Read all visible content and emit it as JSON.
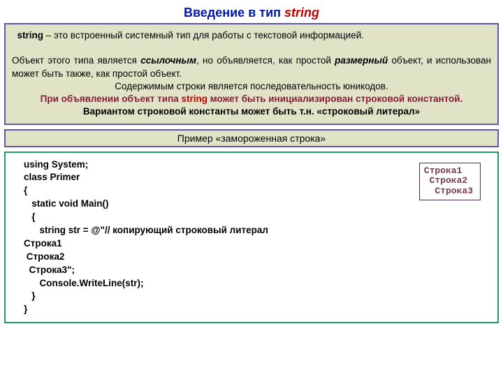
{
  "title_prefix": "Введение в тип ",
  "title_keyword": "string",
  "panel1": {
    "line1_pre": "string",
    "line1_rest": " – это встроенный системный тип для работы с текстовой информацией.",
    "line2_pre": "Объект этого типа является ",
    "line2_em": "ссылочным",
    "line2_mid": ", но объявляется, как простой ",
    "line2_em2": "размерный",
    "line2_post": " объект, и использован может быть также, как простой объект.",
    "line3": "Содержимым  строки  является последовательность юникодов.",
    "line4_pre": "При объявлении объект типа ",
    "line4_kw": "string",
    "line4_post": " может быть инициализирован строковой константой.",
    "line5": "Вариантом строковой константы может быть т.н. «строковый литерал»"
  },
  "panel2_text": "Пример «замороженная строка»",
  "code": "using System;\nclass Primer\n{\n   static void Main()\n   {\n      string str = @\"// копирующий строковый литерал\nСтрока1\n Строка2\n  Строка3\";\n      Console.WriteLine(str);\n   }\n}",
  "output": {
    "line1": "Строка1",
    "line2": " Строка2",
    "line3": "  Строка3"
  }
}
